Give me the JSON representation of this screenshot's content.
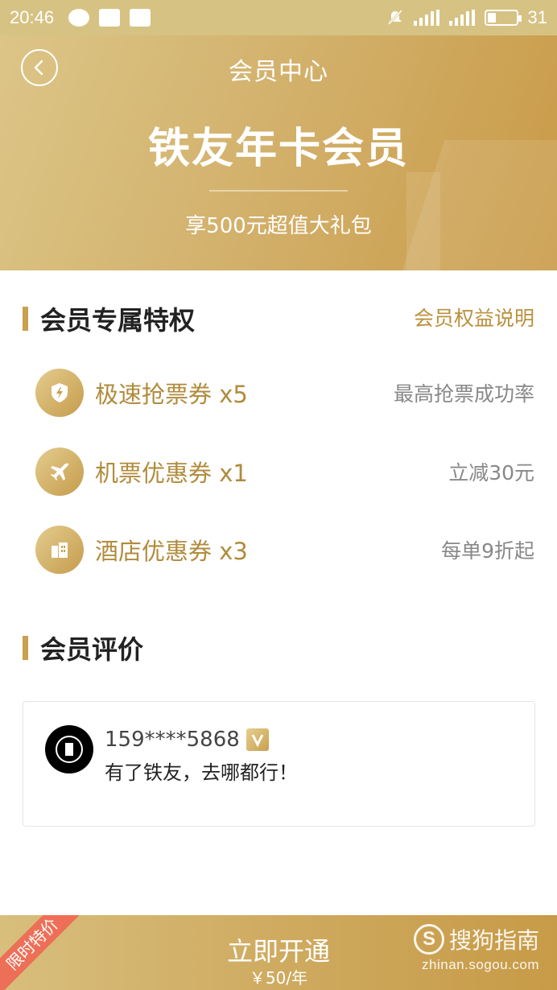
{
  "status_bar": {
    "time": "20:46",
    "battery": "31"
  },
  "header": {
    "title": "会员中心",
    "membership_name": "铁友年卡会员",
    "subtitle": "享500元超值大礼包"
  },
  "privileges": {
    "title": "会员专属特权",
    "link": "会员权益说明",
    "items": [
      {
        "label": "极速抢票券 x5",
        "desc": "最高抢票成功率",
        "icon": "lightning-shield-icon"
      },
      {
        "label": "机票优惠券 x1",
        "desc": "立减30元",
        "icon": "airplane-icon"
      },
      {
        "label": "酒店优惠券 x3",
        "desc": "每单9折起",
        "icon": "hotel-building-icon"
      }
    ]
  },
  "reviews": {
    "title": "会员评价",
    "items": [
      {
        "user": "159****5868",
        "text": "有了铁友，去哪都行！"
      }
    ]
  },
  "footer": {
    "badge": "限时特价",
    "cta": "立即开通",
    "price": "￥50/年",
    "watermark_title": "搜狗指南",
    "watermark_url": "zhinan.sogou.com"
  },
  "colors": {
    "gold": "#c9a04d",
    "gold_text": "#b18b3c",
    "ribbon": "#ee6f57"
  }
}
